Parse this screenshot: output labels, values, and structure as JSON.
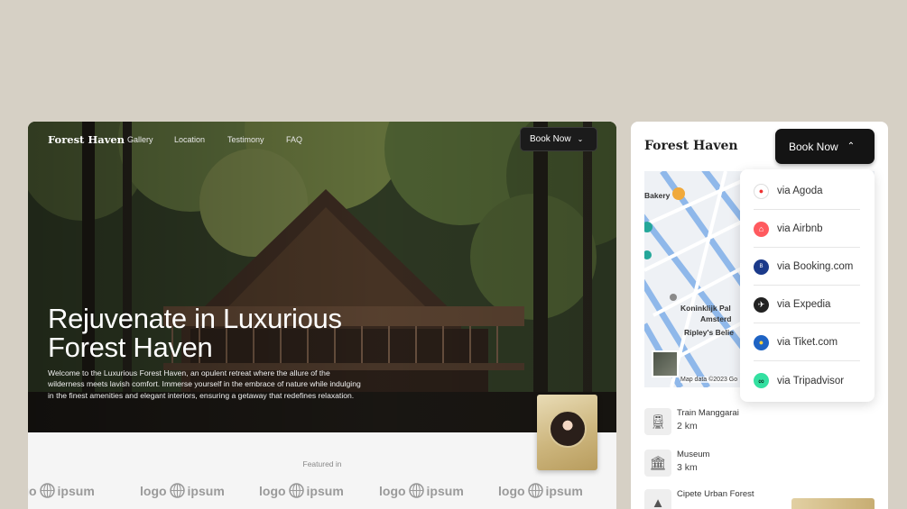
{
  "left": {
    "brand": "Forest Haven",
    "nav": [
      "Gallery",
      "Location",
      "Testimony",
      "FAQ"
    ],
    "book_label": "Book Now",
    "hero_title_1": "Rejuvenate in Luxurious",
    "hero_title_2": "Forest Haven",
    "hero_desc": "Welcome to the Luxurious Forest Haven, an opulent retreat where the allure of the wilderness meets lavish comfort. Immerse yourself in the embrace of nature while indulging in the finest amenities and elegant interiors, ensuring a getaway that redefines relaxation.",
    "featured": "Featured in",
    "logos": [
      {
        "a": "logo",
        "b": "ipsum"
      },
      {
        "a": "logo",
        "b": "ipsum"
      },
      {
        "a": "logo",
        "b": "ipsum"
      },
      {
        "a": "logo",
        "b": "ipsum"
      },
      {
        "a": "logo",
        "b": "ipsum"
      }
    ]
  },
  "right": {
    "brand": "Forest Haven",
    "book_label": "Book Now",
    "map": {
      "credit": "Map data ©2023 Go",
      "labels": [
        "Bakery",
        "Koninklijk Pal",
        "Amsterd",
        "Ripley's Belie"
      ]
    },
    "booking_options": [
      {
        "label": "via Agoda",
        "icon": "agoda-icon",
        "color": "#ffffff"
      },
      {
        "label": "via Airbnb",
        "icon": "airbnb-icon",
        "color": "#ff5a5f"
      },
      {
        "label": "via Booking.com",
        "icon": "booking-icon",
        "color": "#1b3a8a"
      },
      {
        "label": "via Expedia",
        "icon": "expedia-icon",
        "color": "#222222"
      },
      {
        "label": "via Tiket.com",
        "icon": "tiket-icon",
        "color": "#1e63c4"
      },
      {
        "label": "via Tripadvisor",
        "icon": "tripadvisor-icon",
        "color": "#34e0a1"
      }
    ],
    "places": [
      {
        "name": "Train Manggarai",
        "dist": "2 km",
        "icon": "train-icon"
      },
      {
        "name": "Museum",
        "dist": "3 km",
        "icon": "museum-icon"
      },
      {
        "name": "Cipete Urban Forest",
        "dist": "",
        "icon": "forest-icon"
      }
    ]
  }
}
